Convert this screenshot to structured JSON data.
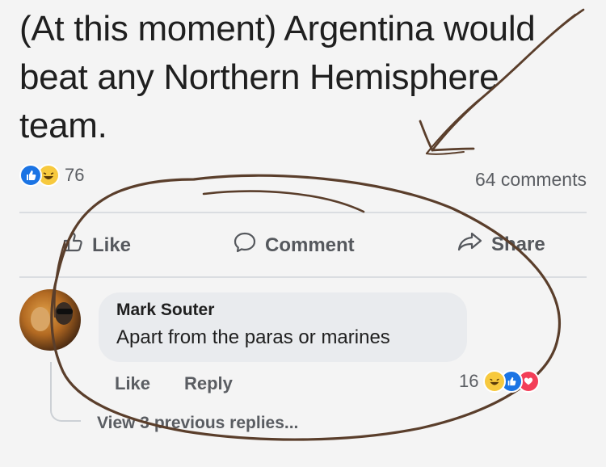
{
  "post": {
    "text": "(At this moment) Argentina would beat any Northern Hemisphere team.",
    "reaction_count": "76",
    "comments_count": "64 comments"
  },
  "actions": {
    "like": "Like",
    "comment": "Comment",
    "share": "Share"
  },
  "comment": {
    "author": "Mark Souter",
    "text": "Apart from the paras or marines",
    "like": "Like",
    "reply": "Reply",
    "reaction_count": "16"
  },
  "view_replies": "View 3 previous replies...",
  "colors": {
    "like_blue": "#1b74e4",
    "haha_yellow": "#f7c93e",
    "love_red": "#f33e58",
    "pen_ink": "#5a3e2b"
  }
}
